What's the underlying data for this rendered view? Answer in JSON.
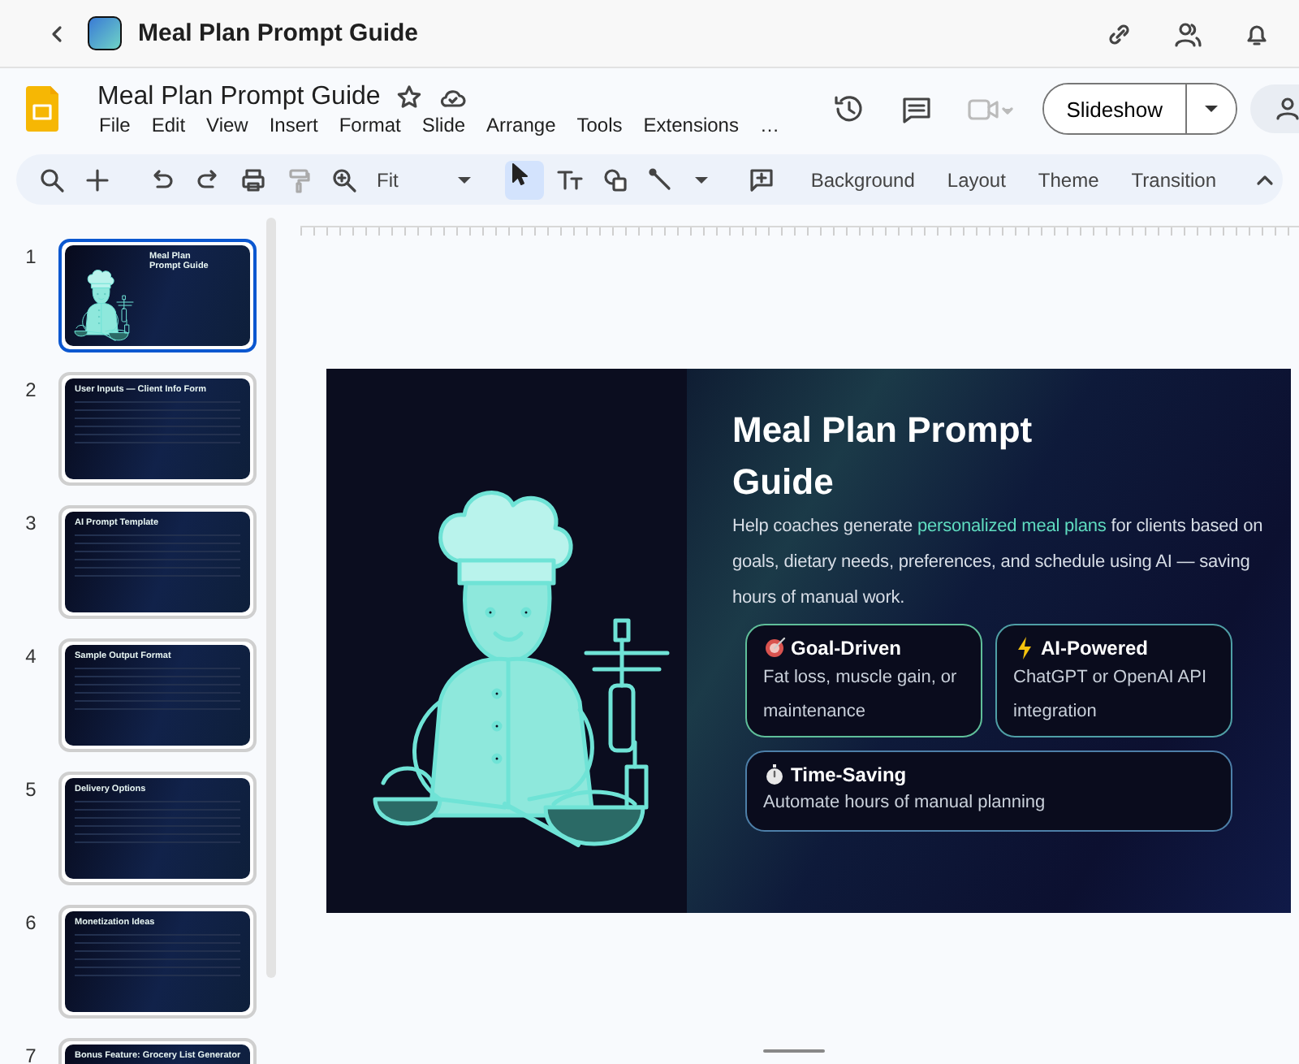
{
  "app_bar": {
    "title": "Meal Plan Prompt Guide"
  },
  "document": {
    "title": "Meal Plan Prompt Guide",
    "starred": false,
    "menus": [
      "File",
      "Edit",
      "View",
      "Insert",
      "Format",
      "Slide",
      "Arrange",
      "Tools",
      "Extensions",
      "…"
    ],
    "slideshow_button": "Slideshow"
  },
  "toolbar": {
    "zoom": "Fit",
    "pointer_selected": true,
    "buttons": [
      "Background",
      "Layout",
      "Theme",
      "Transition"
    ]
  },
  "slides": [
    {
      "number": "1",
      "title": "Meal Plan Prompt Guide",
      "selected": true
    },
    {
      "number": "2",
      "title": "User Inputs — Client Info Form",
      "selected": false
    },
    {
      "number": "3",
      "title": "AI Prompt Template",
      "selected": false
    },
    {
      "number": "4",
      "title": "Sample Output Format",
      "selected": false
    },
    {
      "number": "5",
      "title": "Delivery Options",
      "selected": false
    },
    {
      "number": "6",
      "title": "Monetization Ideas",
      "selected": false
    },
    {
      "number": "7",
      "title": "Bonus Feature: Grocery List Generator",
      "selected": false
    }
  ],
  "slide": {
    "title": "Meal Plan Prompt Guide",
    "description": {
      "before": "Help coaches generate ",
      "highlight": "personalized meal plans",
      "after": " for clients based on goals, dietary needs, preferences, and schedule using AI — saving hours of manual work."
    },
    "cards": [
      {
        "kind": "target",
        "title": "Goal-Driven",
        "text": "Fat loss, muscle gain, or maintenance",
        "color": "#5fbf9a"
      },
      {
        "kind": "bolt",
        "title": "AI-Powered",
        "text": "ChatGPT or OpenAI API integration",
        "color": "#4f9fa6"
      },
      {
        "kind": "stopwatch",
        "title": "Time-Saving",
        "text": "Automate hours of manual planning",
        "color": "#4d7fa8"
      }
    ]
  }
}
